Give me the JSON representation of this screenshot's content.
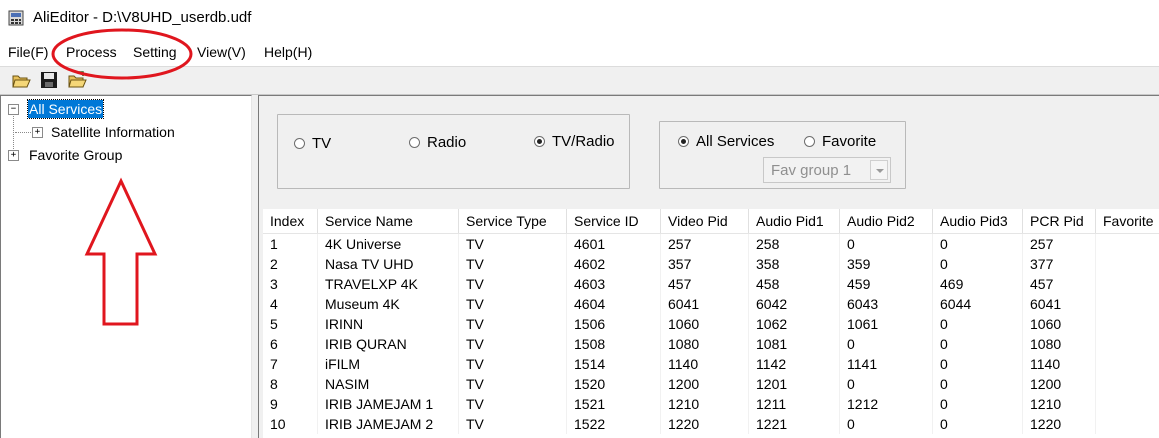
{
  "window": {
    "title": "AliEditor - D:\\V8UHD_userdb.udf"
  },
  "menu": [
    "File(F)",
    "Process",
    "Setting",
    "View(V)",
    "Help(H)"
  ],
  "toolbar": {
    "buttons": [
      "open-folder-icon",
      "save-icon",
      "open-folder-icon"
    ]
  },
  "tree": {
    "items": [
      {
        "label": "All Services",
        "selected": true,
        "expander": "−"
      },
      {
        "label": "Satellite Information",
        "expander": "+"
      },
      {
        "label": "Favorite Group",
        "expander": "+"
      }
    ]
  },
  "filter": {
    "type_options": [
      {
        "label": "TV",
        "checked": false
      },
      {
        "label": "Radio",
        "checked": false
      },
      {
        "label": "TV/Radio",
        "checked": true
      }
    ],
    "scope_options": [
      {
        "label": "All Services",
        "checked": true
      },
      {
        "label": "Favorite",
        "checked": false
      }
    ],
    "fav_group": {
      "value": "Fav group 1",
      "disabled": true
    }
  },
  "table": {
    "columns": [
      "Index",
      "Service Name",
      "Service Type",
      "Service ID",
      "Video Pid",
      "Audio Pid1",
      "Audio Pid2",
      "Audio Pid3",
      "PCR Pid",
      "Favorite"
    ],
    "rows": [
      [
        "1",
        "4K  Universe",
        "TV",
        "4601",
        "257",
        "258",
        "0",
        "0",
        "257",
        ""
      ],
      [
        "2",
        "Nasa TV UHD",
        "TV",
        "4602",
        "357",
        "358",
        "359",
        "0",
        "377",
        ""
      ],
      [
        "3",
        "TRAVELXP 4K",
        "TV",
        "4603",
        "457",
        "458",
        "459",
        "469",
        "457",
        ""
      ],
      [
        "4",
        "Museum 4K",
        "TV",
        "4604",
        "6041",
        "6042",
        "6043",
        "6044",
        "6041",
        ""
      ],
      [
        "5",
        "IRINN",
        "TV",
        "1506",
        "1060",
        "1062",
        "1061",
        "0",
        "1060",
        ""
      ],
      [
        "6",
        "IRIB QURAN",
        "TV",
        "1508",
        "1080",
        "1081",
        "0",
        "0",
        "1080",
        ""
      ],
      [
        "7",
        "iFILM",
        "TV",
        "1514",
        "1140",
        "1142",
        "1141",
        "0",
        "1140",
        ""
      ],
      [
        "8",
        "NASIM",
        "TV",
        "1520",
        "1200",
        "1201",
        "0",
        "0",
        "1200",
        ""
      ],
      [
        "9",
        "IRIB JAMEJAM 1",
        "TV",
        "1521",
        "1210",
        "1211",
        "1212",
        "0",
        "1210",
        ""
      ],
      [
        "10",
        "IRIB JAMEJAM 2",
        "TV",
        "1522",
        "1220",
        "1221",
        "0",
        "0",
        "1220",
        ""
      ]
    ]
  },
  "colors": {
    "selection": "#0078d7",
    "annotation": "#e0161e"
  }
}
